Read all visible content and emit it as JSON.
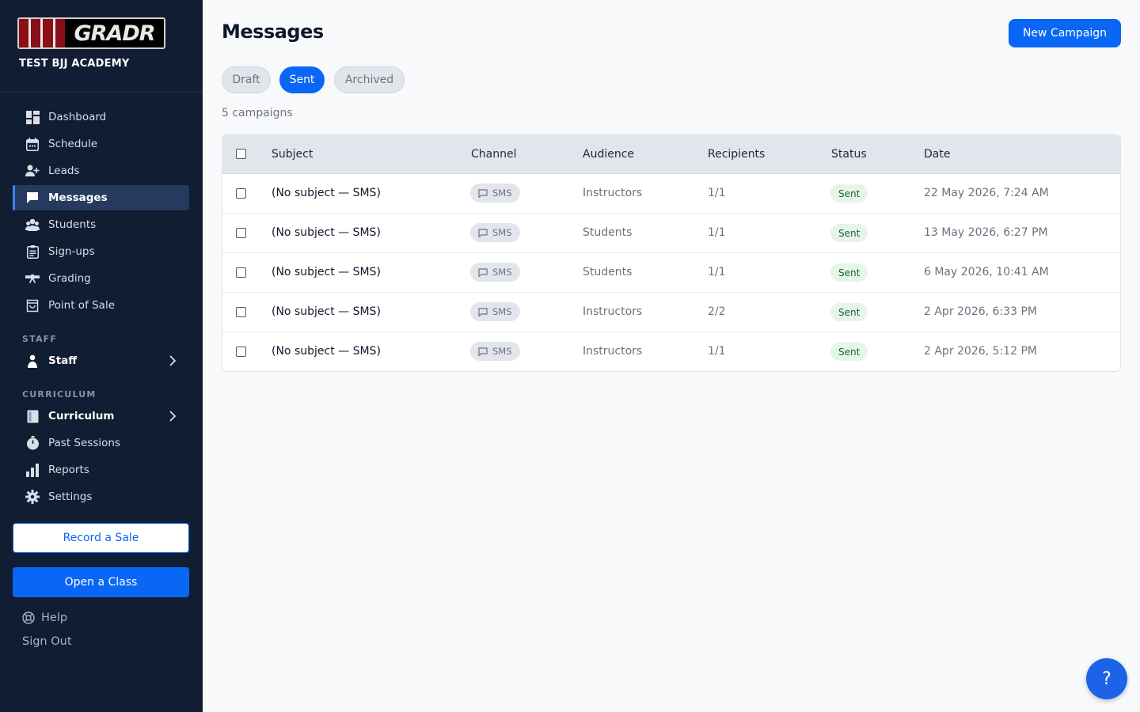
{
  "app": {
    "academy_name": "TEST BJJ ACADEMY",
    "logo_text": "GRADR"
  },
  "sidebar": {
    "items": [
      {
        "label": "Dashboard",
        "icon": "dashboard-icon"
      },
      {
        "label": "Schedule",
        "icon": "calendar-icon"
      },
      {
        "label": "Leads",
        "icon": "user-plus-icon"
      },
      {
        "label": "Messages",
        "icon": "message-icon"
      },
      {
        "label": "Students",
        "icon": "students-icon"
      },
      {
        "label": "Sign-ups",
        "icon": "clipboard-icon"
      },
      {
        "label": "Grading",
        "icon": "belt-icon"
      },
      {
        "label": "Point of Sale",
        "icon": "shopping-bag-icon"
      }
    ],
    "staff_section": "STAFF",
    "staff_label": "Staff",
    "curriculum_section": "CURRICULUM",
    "curriculum_label": "Curriculum",
    "past_sessions": "Past Sessions",
    "reports": "Reports",
    "settings": "Settings",
    "record_sale": "Record a Sale",
    "open_class": "Open a Class",
    "help": "Help",
    "sign_out": "Sign Out"
  },
  "main": {
    "title": "Messages",
    "new_campaign": "New Campaign",
    "tabs": [
      {
        "label": "Draft",
        "active": false
      },
      {
        "label": "Sent",
        "active": true
      },
      {
        "label": "Archived",
        "active": false
      }
    ],
    "count_text": "5 campaigns"
  },
  "table": {
    "columns": [
      "Subject",
      "Channel",
      "Audience",
      "Recipients",
      "Status",
      "Date"
    ],
    "rows": [
      {
        "subject": "(No subject — SMS)",
        "channel": "SMS",
        "audience": "Instructors",
        "recipients": "1/1",
        "status": "Sent",
        "date": "22 May 2026, 7:24 AM"
      },
      {
        "subject": "(No subject — SMS)",
        "channel": "SMS",
        "audience": "Students",
        "recipients": "1/1",
        "status": "Sent",
        "date": "13 May 2026, 6:27 PM"
      },
      {
        "subject": "(No subject — SMS)",
        "channel": "SMS",
        "audience": "Students",
        "recipients": "1/1",
        "status": "Sent",
        "date": "6 May 2026, 10:41 AM"
      },
      {
        "subject": "(No subject — SMS)",
        "channel": "SMS",
        "audience": "Instructors",
        "recipients": "2/2",
        "status": "Sent",
        "date": "2 Apr 2026, 6:33 PM"
      },
      {
        "subject": "(No subject — SMS)",
        "channel": "SMS",
        "audience": "Instructors",
        "recipients": "1/1",
        "status": "Sent",
        "date": "2 Apr 2026, 5:12 PM"
      }
    ]
  },
  "help_fab": "?",
  "colors": {
    "sidebar_bg": "#111d33",
    "accent": "#0a66f5",
    "status_sent_bg": "#e6f4ea",
    "status_sent_text": "#166534"
  }
}
